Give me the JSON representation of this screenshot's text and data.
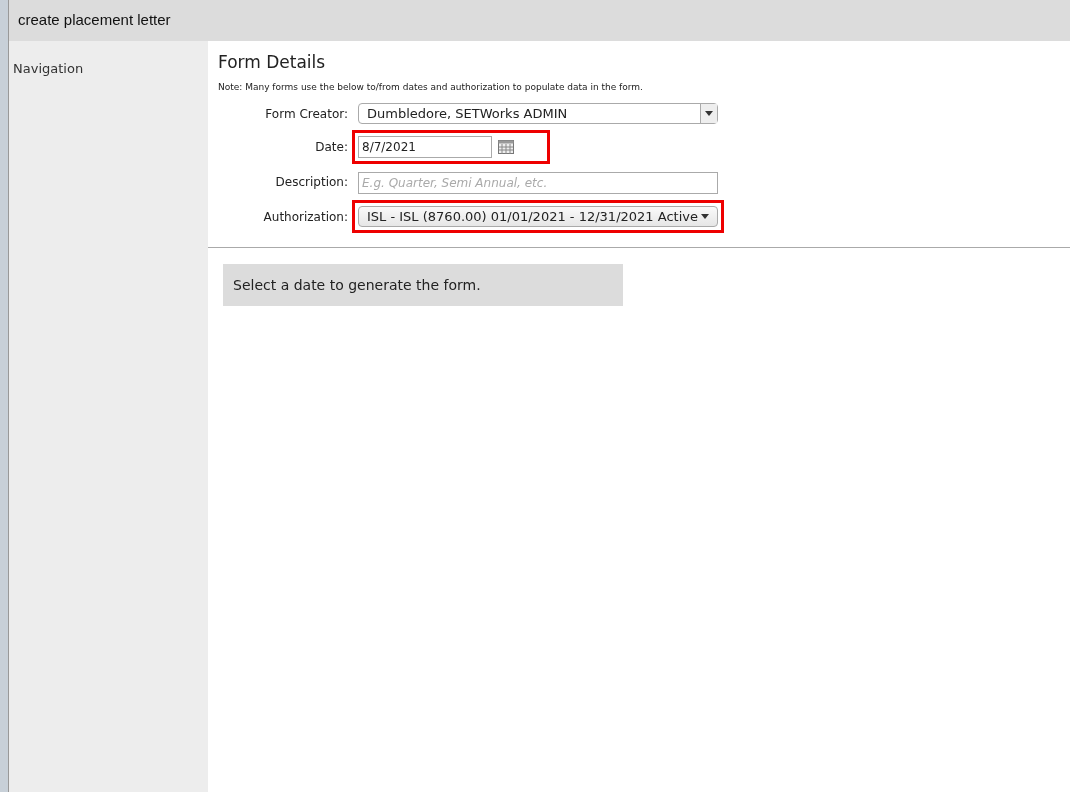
{
  "window": {
    "title": "create placement letter"
  },
  "sidebar": {
    "title": "Navigation"
  },
  "form": {
    "title": "Form Details",
    "note": "Note: Many forms use the below to/from dates and authorization to populate data in the form.",
    "fields": [
      {
        "kind": "select",
        "label": "Form Creator:",
        "value": "Dumbledore, SETWorks ADMIN",
        "highlighted": false
      },
      {
        "kind": "date",
        "label": "Date:",
        "value": "8/7/2021",
        "highlighted": true
      },
      {
        "kind": "text",
        "label": "Description:",
        "placeholder": "E.g. Quarter, Semi Annual, etc.",
        "highlighted": false
      },
      {
        "kind": "button-select",
        "label": "Authorization:",
        "value": "ISL - ISL (8760.00) 01/01/2021 - 12/31/2021 Active",
        "highlighted": true
      }
    ]
  },
  "message": "Select a date to generate the form."
}
